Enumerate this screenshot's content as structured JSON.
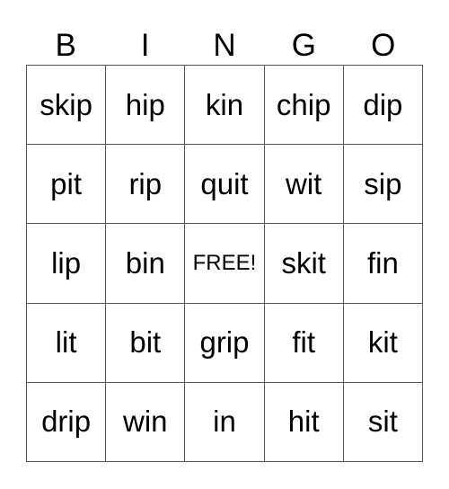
{
  "header": [
    "B",
    "I",
    "N",
    "G",
    "O"
  ],
  "rows": [
    [
      "skip",
      "hip",
      "kin",
      "chip",
      "dip"
    ],
    [
      "pit",
      "rip",
      "quit",
      "wit",
      "sip"
    ],
    [
      "lip",
      "bin",
      "FREE!",
      "skit",
      "fin"
    ],
    [
      "lit",
      "bit",
      "grip",
      "fit",
      "kit"
    ],
    [
      "drip",
      "win",
      "in",
      "hit",
      "sit"
    ]
  ],
  "free_cell": {
    "row": 2,
    "col": 2
  }
}
